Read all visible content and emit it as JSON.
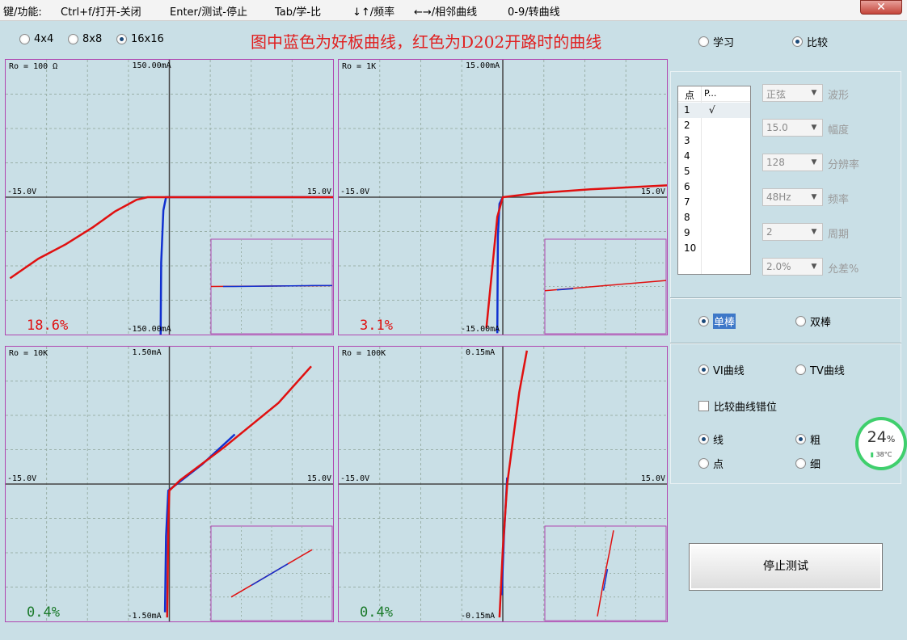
{
  "menu": {
    "items": [
      "键/功能:",
      "Ctrl+f/打开-关闭",
      "Enter/测试-停止",
      "Tab/学-比",
      "↓↑/频率",
      "←→/相邻曲线",
      "0-9/转曲线"
    ],
    "close": "✕"
  },
  "grid_modes": [
    {
      "label": "4x4",
      "selected": false
    },
    {
      "label": "8x8",
      "selected": false
    },
    {
      "label": "16x16",
      "selected": true
    }
  ],
  "headline": "图中蓝色为好板曲线，红色为D202开路时的曲线",
  "mode": {
    "learn": {
      "label": "学习",
      "selected": false
    },
    "compare": {
      "label": "比较",
      "selected": true
    }
  },
  "panels": [
    {
      "ro": "Ro = 100 Ω",
      "ytop": "150.00mA",
      "ybot": "-150.00mA",
      "xleft": "-15.0V",
      "xright": "15.0V",
      "percent": "18.6%",
      "red": [
        [
          -14.6,
          -0.62
        ],
        [
          -12,
          -0.47
        ],
        [
          -9.5,
          -0.36
        ],
        [
          -7,
          -0.23
        ],
        [
          -5,
          -0.11
        ],
        [
          -3,
          -0.02
        ],
        [
          -2,
          0
        ],
        [
          0,
          0
        ],
        [
          5,
          0
        ],
        [
          15,
          0
        ]
      ],
      "blue": [
        [
          -0.8,
          -1.06
        ],
        [
          -0.75,
          -0.5
        ],
        [
          -0.55,
          -0.1
        ],
        [
          -0.3,
          0
        ],
        [
          0,
          0
        ],
        [
          10,
          0
        ],
        [
          15,
          0
        ]
      ],
      "inset_red": [
        [
          -15,
          0
        ],
        [
          15,
          0.02
        ]
      ],
      "inset_blue": [
        [
          -12,
          0
        ],
        [
          -9,
          0
        ],
        [
          10,
          0.02
        ],
        [
          15,
          0.02
        ]
      ]
    },
    {
      "ro": "Ro = 1K",
      "ytop": "15.00mA",
      "ybot": "-15.00mA",
      "xleft": "-15.0V",
      "xright": "15.0V",
      "percent": "3.1%",
      "red": [
        [
          -1.5,
          -1.0
        ],
        [
          -0.5,
          -0.15
        ],
        [
          0,
          0
        ],
        [
          1,
          0.01
        ],
        [
          3,
          0.03
        ],
        [
          8,
          0.06
        ],
        [
          15,
          0.09
        ]
      ],
      "blue": [
        [
          -0.5,
          -1.04
        ],
        [
          -0.45,
          -0.3
        ],
        [
          -0.3,
          -0.05
        ],
        [
          0,
          0
        ]
      ],
      "inset_red": [
        [
          -15,
          -0.1
        ],
        [
          0,
          0.02
        ],
        [
          15,
          0.14
        ]
      ],
      "inset_blue": [
        [
          -12,
          -0.08
        ],
        [
          -8,
          -0.05
        ]
      ]
    },
    {
      "ro": "Ro = 10K",
      "ytop": "1.50mA",
      "ybot": "-1.50mA",
      "xleft": "-15.0V",
      "xright": "15.0V",
      "percent": "0.4%",
      "red": [
        [
          -0.2,
          -1.02
        ],
        [
          -0.1,
          -0.3
        ],
        [
          0,
          -0.05
        ],
        [
          1,
          0.03
        ],
        [
          5,
          0.28
        ],
        [
          10,
          0.62
        ],
        [
          13,
          0.9
        ]
      ],
      "blue": [
        [
          -0.4,
          -0.98
        ],
        [
          -0.3,
          -0.4
        ],
        [
          -0.1,
          -0.05
        ],
        [
          3,
          0.15
        ],
        [
          6,
          0.38
        ]
      ],
      "inset_red": [
        [
          -10,
          -0.55
        ],
        [
          10,
          0.55
        ]
      ],
      "inset_blue": [
        [
          -5,
          -0.28
        ],
        [
          4,
          0.22
        ]
      ]
    },
    {
      "ro": "Ro = 100K",
      "ytop": "0.15mA",
      "ybot": "-0.15mA",
      "xleft": "-15.0V",
      "xright": "15.0V",
      "percent": "0.4%",
      "red": [
        [
          -0.3,
          -1.02
        ],
        [
          0,
          -0.5
        ],
        [
          0.4,
          0
        ],
        [
          1.5,
          0.7
        ],
        [
          2.2,
          1.02
        ]
      ],
      "blue": [
        [
          -0.1,
          -0.85
        ],
        [
          0.1,
          -0.4
        ],
        [
          0.4,
          0.05
        ]
      ],
      "inset_red": [
        [
          -2,
          -1.0
        ],
        [
          -0.5,
          -0.2
        ],
        [
          1,
          0.5
        ],
        [
          2,
          1.0
        ]
      ],
      "inset_blue": [
        [
          -0.5,
          -0.4
        ],
        [
          0.5,
          0.1
        ]
      ]
    }
  ],
  "point_list": {
    "header": [
      "点",
      "P..."
    ],
    "rows": [
      {
        "n": "1",
        "mark": "√"
      },
      {
        "n": "2",
        "mark": ""
      },
      {
        "n": "3",
        "mark": ""
      },
      {
        "n": "4",
        "mark": ""
      },
      {
        "n": "5",
        "mark": ""
      },
      {
        "n": "6",
        "mark": ""
      },
      {
        "n": "7",
        "mark": ""
      },
      {
        "n": "8",
        "mark": ""
      },
      {
        "n": "9",
        "mark": ""
      },
      {
        "n": "10",
        "mark": ""
      }
    ]
  },
  "params": [
    {
      "value": "正弦",
      "label": "波形"
    },
    {
      "value": "15.0",
      "label": "幅度"
    },
    {
      "value": "128",
      "label": "分辨率"
    },
    {
      "value": "48Hz",
      "label": "频率"
    },
    {
      "value": "2",
      "label": "周期"
    },
    {
      "value": "2.0%",
      "label": "允差%"
    }
  ],
  "probe": {
    "single": {
      "label": "单棒",
      "selected": true
    },
    "double": {
      "label": "双棒",
      "selected": false
    }
  },
  "curve_type": {
    "vi": {
      "label": "VI曲线",
      "selected": true
    },
    "tv": {
      "label": "TV曲线",
      "selected": false
    }
  },
  "offset_label": "比较曲线错位",
  "draw_style": {
    "line": {
      "label": "线",
      "selected": true
    },
    "point": {
      "label": "点",
      "selected": false
    },
    "thick": {
      "label": "粗",
      "selected": true
    },
    "thin": {
      "label": "细",
      "selected": false
    }
  },
  "stop_button": "停止测试",
  "gauge": {
    "percent": "24",
    "percent_sign": "%",
    "temp": "38°C"
  },
  "colors": {
    "good_curve": "#1030d0",
    "fault_curve": "#e01010",
    "panel_border": "#b045b0",
    "grid": "#9ab0a8",
    "axis": "#444444"
  }
}
